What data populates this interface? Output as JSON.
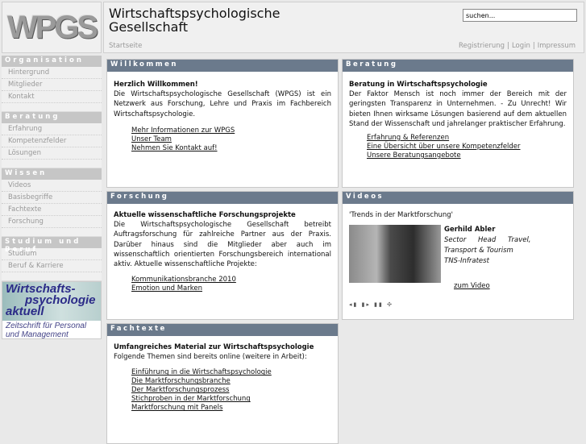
{
  "header": {
    "logo": "WPGS",
    "title_line1": "Wirtschaftspsychologische",
    "title_line2": "Gesellschaft",
    "breadcrumb": "Startseite",
    "search_placeholder": "suchen...",
    "links": [
      "Registrierung",
      "Login",
      "Impressum"
    ]
  },
  "sidebar": {
    "sections": [
      {
        "title": "Organisation",
        "items": [
          "Hintergrund",
          "Mitglieder",
          "Kontakt"
        ]
      },
      {
        "title": "Beratung",
        "items": [
          "Erfahrung",
          "Kompetenzfelder",
          "Lösungen"
        ]
      },
      {
        "title": "Wissen",
        "items": [
          "Videos",
          "Basisbegriffe",
          "Fachtexte",
          "Forschung"
        ]
      },
      {
        "title": "Studium und Beruf",
        "items": [
          "Studium",
          "Beruf & Karriere"
        ]
      }
    ],
    "ad": {
      "line1": "Wirtschafts-",
      "line2": "psychologie",
      "line3": "aktuell",
      "sub1": "Zeitschrift für Personal",
      "sub2": "und Management"
    }
  },
  "willkommen": {
    "header": "Willkommen",
    "title": "Herzlich Willkommen!",
    "text": "Die Wirtschaftspsychologische Gesellschaft (WPGS) ist ein Netzwerk aus Forschung, Lehre und Praxis im Fachbereich Wirtschaftspsychologie.",
    "links": [
      "Mehr Informationen zur WPGS",
      "Unser Team",
      "Nehmen Sie Kontakt auf!"
    ]
  },
  "beratung": {
    "header": "Beratung",
    "title": "Beratung in Wirtschaftspsychologie",
    "text": "Der Faktor Mensch ist noch immer der Bereich mit der geringsten Transparenz in Unternehmen. - Zu Unrecht! Wir bieten Ihnen wirksame Lösungen basierend auf dem aktuellen Stand der Wissenschaft und jahrelanger praktischer Erfahrung.",
    "links": [
      "Erfahrung & Referenzen",
      "Eine Übersicht über unsere Kompetenzfelder",
      "Unsere Beratungsangebote"
    ]
  },
  "forschung": {
    "header": "Forschung",
    "title": "Aktuelle wissenschaftliche Forschungsprojekte",
    "text": "Die Wirtschaftspsychologische Gesellschaft betreibt Auftragsforschung für zahlreiche Partner aus der Praxis. Darüber hinaus sind die Mitglieder aber auch im wissenschaftlich orientierten Forschungsbereich international aktiv. Aktuelle wissenschaftliche Projekte:",
    "links": [
      "Kommunikationsbranche 2010",
      "Emotion und Marken"
    ]
  },
  "videos": {
    "header": "Videos",
    "caption": "'Trends in der Marktforschung'",
    "name": "Gerhild Abler",
    "role1": "Sector Head Travel,",
    "role2": "Transport & Tourism",
    "company": "TNS-Infratest",
    "link": "zum Video",
    "controls": "◂▮ ▮▸ ▮▮ ✣"
  },
  "fachtexte": {
    "header": "Fachtexte",
    "title": "Umfangreiches Material zur Wirtschaftspsychologie",
    "text": "Folgende Themen sind bereits online (weitere in Arbeit):",
    "links": [
      "Einführung in die Wirtschaftspsychologie",
      "Die Marktforschungsbranche",
      "Der Marktforschungsprozess",
      "Stichproben in der Marktforschung",
      "Marktforschung mit Panels"
    ]
  }
}
